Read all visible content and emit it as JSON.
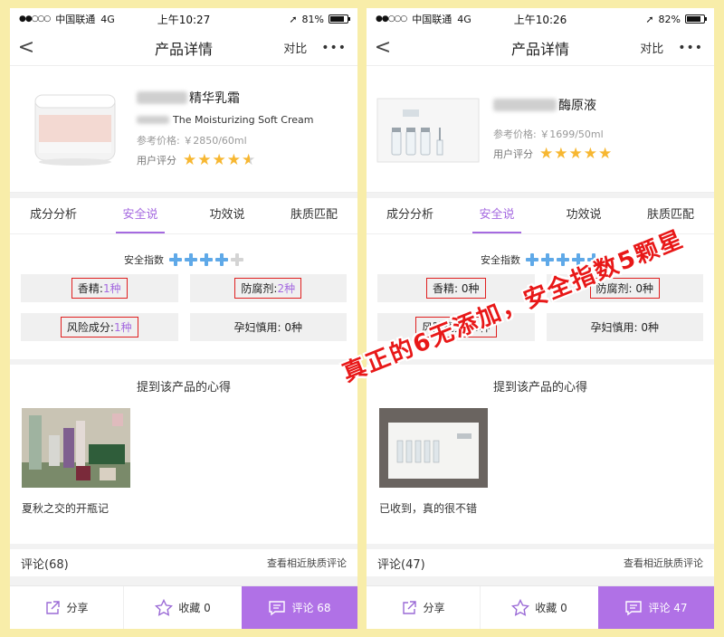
{
  "overlay_text": "真正的6无添加，安全指数5颗星",
  "phones": {
    "left": {
      "status": {
        "carrier": "中国联通",
        "network": "4G",
        "time": "上午10:27",
        "battery": "81%",
        "battery_level": 0.81
      },
      "nav": {
        "back": "<",
        "title": "产品详情",
        "compare": "对比",
        "more": "•••"
      },
      "product": {
        "name": "精华乳霜",
        "subtitle": "The Moisturizing Soft Cream",
        "price": "参考价格: ￥2850/60ml",
        "rating_label": "用户评分",
        "rating": 4.5
      },
      "tabs": [
        "成分分析",
        "安全说",
        "功效说",
        "肤质匹配"
      ],
      "active_tab": 1,
      "safety": {
        "label": "安全指数",
        "score": 4,
        "max": 5,
        "fragrance_label": "香精: ",
        "fragrance_value": "1种",
        "preservative_label": "防腐剂: ",
        "preservative_value": "2种",
        "risk_label": "风险成分: ",
        "risk_value": "1种",
        "pregnancy": "孕妇慎用: 0种"
      },
      "reviews": {
        "title": "提到该产品的心得",
        "text": "夏秋之交的开瓶记"
      },
      "comments": {
        "count": "评论(68)",
        "link": "查看相近肤质评论"
      },
      "bottom": {
        "share": "分享",
        "fav": "收藏 0",
        "comment": "评论 68"
      }
    },
    "right": {
      "status": {
        "carrier": "中国联通",
        "network": "4G",
        "time": "上午10:26",
        "battery": "82%",
        "battery_level": 0.82
      },
      "nav": {
        "back": "<",
        "title": "产品详情",
        "compare": "对比",
        "more": "•••"
      },
      "product": {
        "name": "酶原液",
        "price": "参考价格: ￥1699/50ml",
        "rating_label": "用户评分",
        "rating": 5
      },
      "tabs": [
        "成分分析",
        "安全说",
        "功效说",
        "肤质匹配"
      ],
      "active_tab": 1,
      "safety": {
        "label": "安全指数",
        "score": 5,
        "max": 5,
        "fragrance": "香精: 0种",
        "preservative": "防腐剂: 0种",
        "risk": "风险成分: 0种",
        "pregnancy": "孕妇慎用: 0种"
      },
      "reviews": {
        "title": "提到该产品的心得",
        "text": "已收到，真的很不错"
      },
      "comments": {
        "count": "评论(47)",
        "link": "查看相近肤质评论"
      },
      "bottom": {
        "share": "分享",
        "fav": "收藏 0",
        "comment": "评论 47"
      }
    }
  },
  "colors": {
    "accent": "#b071e6",
    "star": "#f7b731",
    "cross": "#5fa9e8",
    "highlight": "#e02020",
    "background": "#f8eda9"
  }
}
